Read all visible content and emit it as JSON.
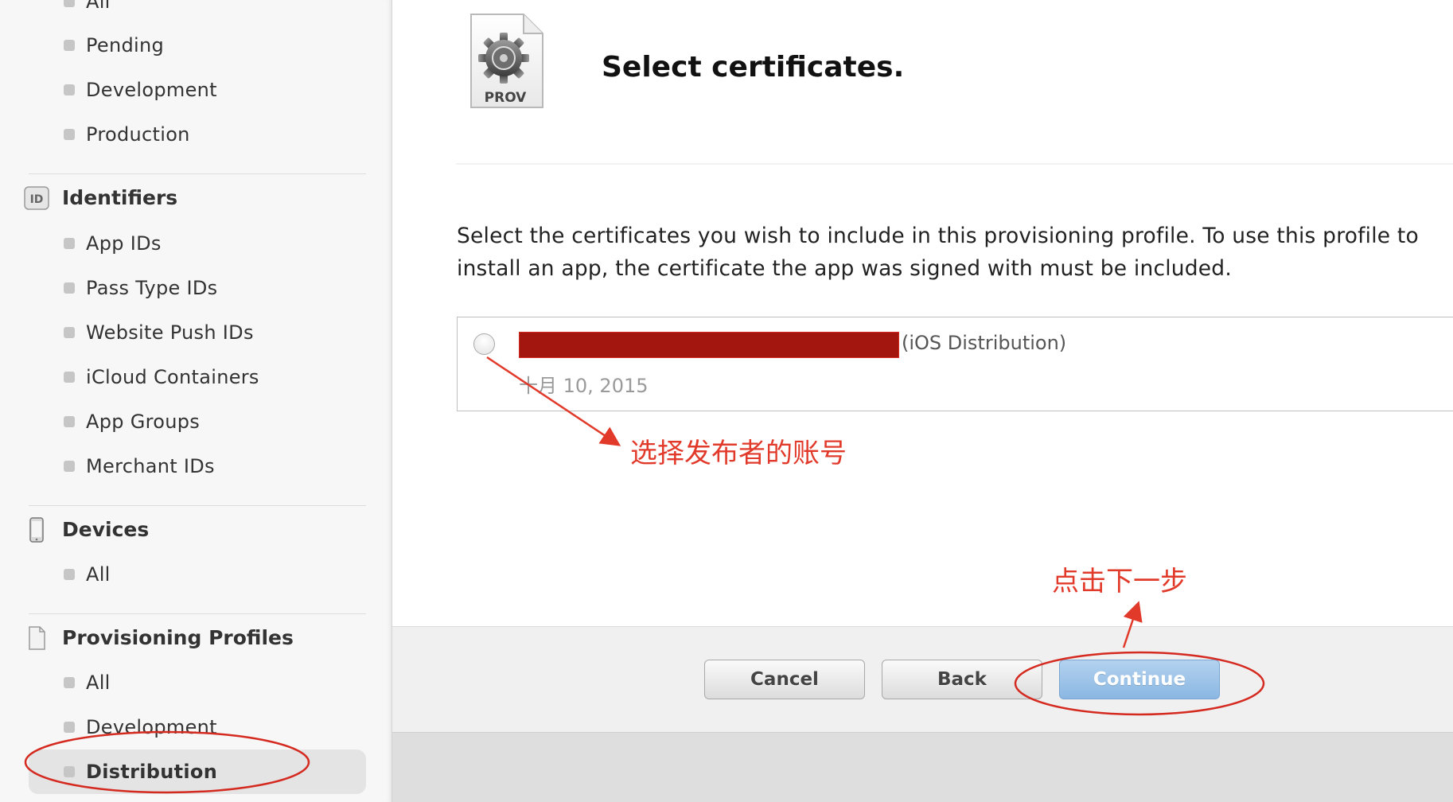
{
  "sidebar": {
    "top_items": [
      "All",
      "Pending",
      "Development",
      "Production"
    ],
    "identifiers": {
      "icon_text": "ID",
      "title": "Identifiers",
      "items": [
        "App IDs",
        "Pass Type IDs",
        "Website Push IDs",
        "iCloud Containers",
        "App Groups",
        "Merchant IDs"
      ]
    },
    "devices": {
      "icon": "iphone-icon",
      "title": "Devices",
      "items": [
        "All"
      ]
    },
    "provisioning": {
      "icon": "document-icon",
      "title": "Provisioning Profiles",
      "items": [
        "All",
        "Development",
        "Distribution"
      ],
      "selected": "Distribution"
    }
  },
  "header": {
    "icon_label": "PROV",
    "title": "Select certificates."
  },
  "description": "Select the certificates you wish to include in this provisioning profile. To use this profile to install an app, the certificate the app was signed with must be included.",
  "certificate": {
    "type": "(iOS Distribution)",
    "date": "十月 10, 2015",
    "selected": false
  },
  "annotations": {
    "select_account": "选择发布者的账号",
    "click_next": "点击下一步"
  },
  "buttons": {
    "cancel": "Cancel",
    "back": "Back",
    "continue": "Continue"
  },
  "colors": {
    "annotation": "#e23a2a",
    "redaction": "#a3150f",
    "continue_button": "#8ab7e2",
    "sidebar_selected": "#e4e4e4"
  }
}
